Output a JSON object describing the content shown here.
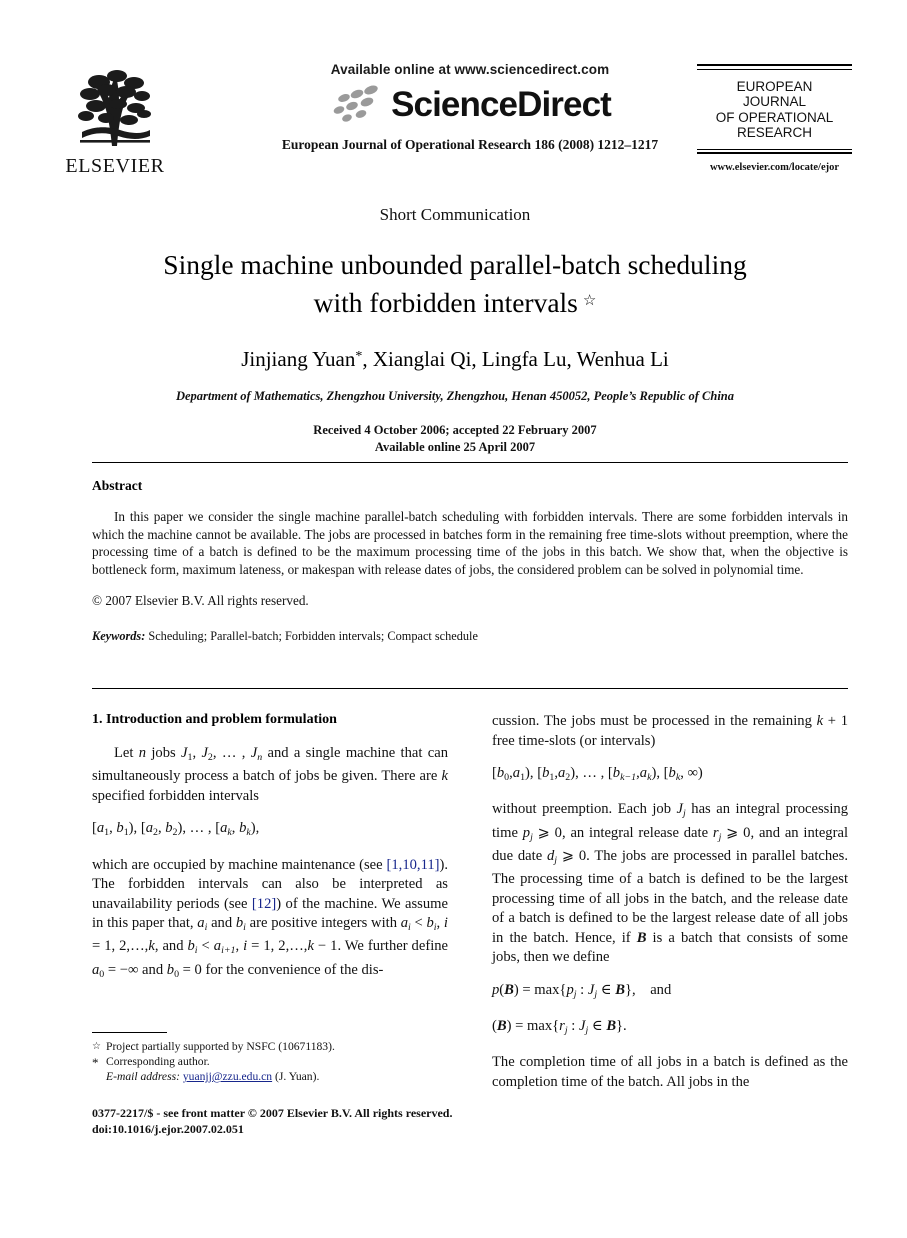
{
  "masthead": {
    "publisher_name": "ELSEVIER",
    "available_online": "Available online at www.sciencedirect.com",
    "sciencedirect_wordmark": "ScienceDirect",
    "journal_citation_line": "European Journal of Operational Research 186 (2008) 1212–1217",
    "journal_logo_lines": [
      "EUROPEAN",
      "JOURNAL",
      "OF OPERATIONAL",
      "RESEARCH"
    ],
    "journal_url": "www.elsevier.com/locate/ejor"
  },
  "title_block": {
    "article_type": "Short Communication",
    "title_line_1": "Single machine unbounded parallel-batch scheduling",
    "title_line_2": "with forbidden intervals",
    "title_footnote_marker": "☆",
    "authors": "Jinjiang Yuan",
    "author_marker": "*",
    "authors_rest": ", Xianglai Qi, Lingfa Lu, Wenhua Li",
    "affiliation": "Department of Mathematics, Zhengzhou University, Zhengzhou, Henan 450052, People’s Republic of China",
    "received_line": "Received 4 October 2006; accepted 22 February 2007",
    "available_line": "Available online 25 April 2007"
  },
  "abstract": {
    "heading": "Abstract",
    "body": "In this paper we consider the single machine parallel-batch scheduling with forbidden intervals. There are some forbidden intervals in which the machine cannot be available. The jobs are processed in batches form in the remaining free time-slots without preemption, where the processing time of a batch is defined to be the maximum processing time of the jobs in this batch. We show that, when the objective is bottleneck form, maximum lateness, or makespan with release dates of jobs, the considered problem can be solved in polynomial time.",
    "copyright": "© 2007 Elsevier B.V. All rights reserved.",
    "keywords_label": "Keywords:",
    "keywords_value": "Scheduling; Parallel-batch; Forbidden intervals; Compact schedule"
  },
  "body": {
    "section_heading": "1. Introduction and problem formulation",
    "left_p1_a": "Let ",
    "left_p1_n": "n",
    "left_p1_b": " jobs ",
    "left_p1_c": " and a single machine that can simultaneously process a batch of jobs be given. There are ",
    "left_p1_k": "k",
    "left_p1_d": " specified forbidden intervals",
    "left_eq1": "[a₁, b₁), [a₂, b₂), … , [aₖ, bₖ),",
    "left_p2_a": "which are occupied by machine maintenance (see ",
    "left_cite_1": "[1,10,11]",
    "left_p2_b": "). The forbidden intervals can also be interpreted as unavailability periods (see ",
    "left_cite_2": "[12]",
    "left_p2_c": ") of the machine. We assume in this paper that, ",
    "left_p2_d": " are positive integers with ",
    "left_p2_e": " We further define ",
    "left_p2_f": " for the convenience of the dis-",
    "right_p1": "cussion. The jobs must be processed in the remaining ",
    "right_p1_b": " free time-slots (or intervals)",
    "right_eq1": "[b₀, a₁), [b₁, a₂), … , [bₖ₋₁, aₖ), [bₖ, ∞)",
    "right_p2": "without preemption. Each job ",
    "right_p2_b": " has an integral processing time ",
    "right_p2_c": ", an integral release date ",
    "right_p2_d": ", and an integral due date ",
    "right_p2_e": ". The jobs are processed in parallel batches. The processing time of a batch is defined to be the largest processing time of all jobs in the batch, and the release date of a batch is defined to be the largest release date of all jobs in the batch. Hence, if ",
    "right_p2_f": " is a batch that consists of some jobs, then we define",
    "right_eq2": "p(B) = max{pⱼ : Jⱼ ∈ B},    and",
    "right_eq3": "(B) = max{rⱼ : Jⱼ ∈ B}.",
    "right_p3": "The completion time of all jobs in a batch is defined as the completion time of the batch. All jobs in the"
  },
  "footnotes": {
    "marker_1": "☆",
    "text_1": "Project partially supported by NSFC (10671183).",
    "marker_2": "*",
    "text_2": "Corresponding author.",
    "email_label": "E-mail address:",
    "email_value": "yuanjj@zzu.edu.cn",
    "email_suffix": "(J. Yuan)."
  },
  "footer": {
    "issn_line": "0377-2217/$ - see front matter © 2007 Elsevier B.V. All rights reserved.",
    "doi_line": "doi:10.1016/j.ejor.2007.02.051"
  },
  "colors": {
    "link": "#17268c",
    "text": "#111111"
  }
}
